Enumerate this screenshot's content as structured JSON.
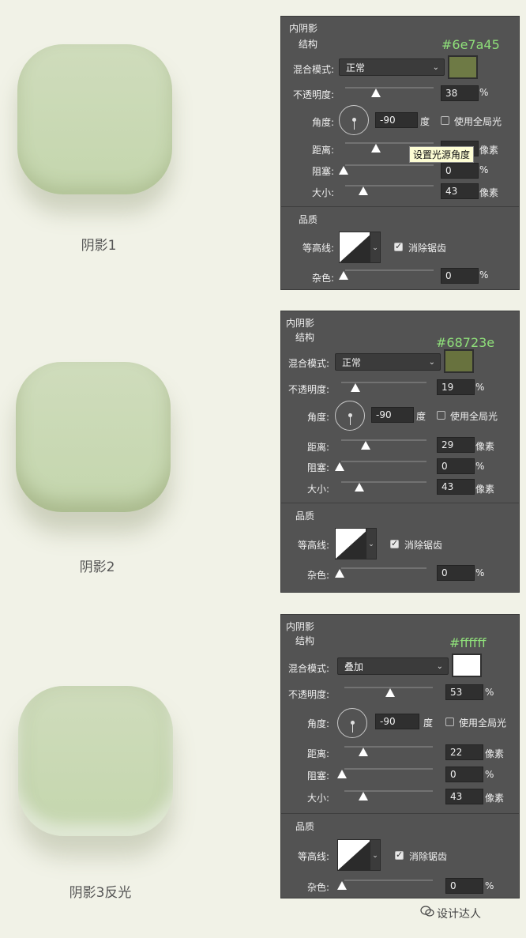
{
  "tiles": [
    {
      "caption": "阴影1"
    },
    {
      "caption": "阴影2"
    },
    {
      "caption": "阴影3反光"
    }
  ],
  "panels": [
    {
      "section_title": "内阴影",
      "structure_title": "结构",
      "hex": "#6e7a45",
      "swatch_color": "#6e7a45",
      "blend_label": "混合模式:",
      "blend_value": "正常",
      "opacity_label": "不透明度:",
      "opacity_value": "38",
      "opacity_pct": 38,
      "angle_label": "角度:",
      "angle_value": "-90",
      "angle_unit": "度",
      "global_light_label": "使用全局光",
      "distance_label": "距离:",
      "distance_value": "",
      "distance_unit": "像素",
      "tooltip": "设置光源角度",
      "choke_label": "阻塞:",
      "choke_value": "0",
      "size_label": "大小:",
      "size_value": "43",
      "size_unit": "像素",
      "quality_title": "品质",
      "contour_label": "等高线:",
      "antialias_label": "消除锯齿",
      "noise_label": "杂色:",
      "noise_value": "0",
      "pct": "%"
    },
    {
      "section_title": "内阴影",
      "structure_title": "结构",
      "hex": "#68723e",
      "swatch_color": "#68723e",
      "blend_label": "混合模式:",
      "blend_value": "正常",
      "opacity_label": "不透明度:",
      "opacity_value": "19",
      "opacity_pct": 19,
      "angle_label": "角度:",
      "angle_value": "-90",
      "angle_unit": "度",
      "global_light_label": "使用全局光",
      "distance_label": "距离:",
      "distance_value": "29",
      "distance_unit": "像素",
      "choke_label": "阻塞:",
      "choke_value": "0",
      "size_label": "大小:",
      "size_value": "43",
      "size_unit": "像素",
      "quality_title": "品质",
      "contour_label": "等高线:",
      "antialias_label": "消除锯齿",
      "noise_label": "杂色:",
      "noise_value": "0",
      "pct": "%"
    },
    {
      "section_title": "内阴影",
      "structure_title": "结构",
      "hex": "#ffffff",
      "swatch_color": "#ffffff",
      "blend_label": "混合模式:",
      "blend_value": "叠加",
      "opacity_label": "不透明度:",
      "opacity_value": "53",
      "opacity_pct": 53,
      "angle_label": "角度:",
      "angle_value": "-90",
      "angle_unit": "度",
      "global_light_label": "使用全局光",
      "distance_label": "距离:",
      "distance_value": "22",
      "distance_unit": "像素",
      "choke_label": "阻塞:",
      "choke_value": "0",
      "size_label": "大小:",
      "size_value": "43",
      "size_unit": "像素",
      "quality_title": "品质",
      "contour_label": "等高线:",
      "antialias_label": "消除锯齿",
      "noise_label": "杂色:",
      "noise_value": "0",
      "pct": "%"
    }
  ],
  "watermark": "设计达人",
  "colors": {
    "background": "#f1f2e7",
    "panel": "#535353",
    "hex_text": "#8fe07a"
  }
}
